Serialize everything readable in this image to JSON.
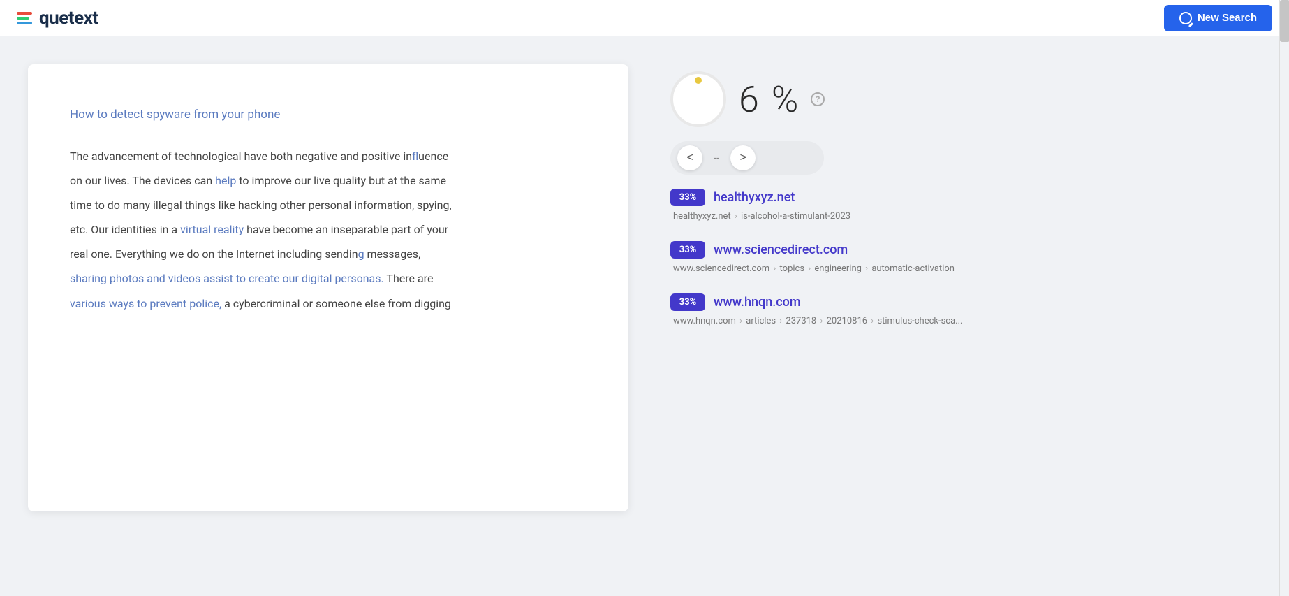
{
  "header": {
    "logo_text": "quetext",
    "new_search_label": "New Search"
  },
  "score": {
    "value": "6",
    "symbol": "%",
    "help_label": "?"
  },
  "navigation": {
    "prev_label": "<",
    "next_label": ">",
    "counter": "--"
  },
  "document": {
    "title": "How to detect spyware from your phone",
    "paragraphs": [
      "The advancement of technological have both negative and positive influence",
      "on our lives. The devices can help to improve our live quality but at the same",
      "time to do many illegal things like hacking other personal information, spying,",
      "etc. Our identities in a virtual reality have become an inseparable part of your",
      "real one. Everything we do on the Internet including sending messages,",
      "sharing photos and videos assist to create our digital personas. There are",
      "various ways to prevent police, a cybercriminal or someone else from digging"
    ],
    "highlighted_words": [
      "How",
      "to",
      "detect",
      "spyware",
      "from",
      "your",
      "phone",
      "help",
      "virtual",
      "reality",
      "sharing",
      "photos",
      "and",
      "videos",
      "assist",
      "to",
      "create",
      "our",
      "digital",
      "personas",
      "There",
      "are",
      "various",
      "ways",
      "to",
      "prevent",
      "police"
    ]
  },
  "results": [
    {
      "badge": "33%",
      "domain": "healthyxyz.net",
      "breadcrumb_parts": [
        "healthyxyz.net",
        "is-alcohol-a-stimulant-2023"
      ]
    },
    {
      "badge": "33%",
      "domain": "www.sciencedirect.com",
      "breadcrumb_parts": [
        "www.sciencedirect.com",
        "topics",
        "engineering",
        "automatic-activation"
      ]
    },
    {
      "badge": "33%",
      "domain": "www.hnqn.com",
      "breadcrumb_parts": [
        "www.hnqn.com",
        "articles",
        "237318",
        "20210816",
        "stimulus-check-sca..."
      ]
    }
  ]
}
